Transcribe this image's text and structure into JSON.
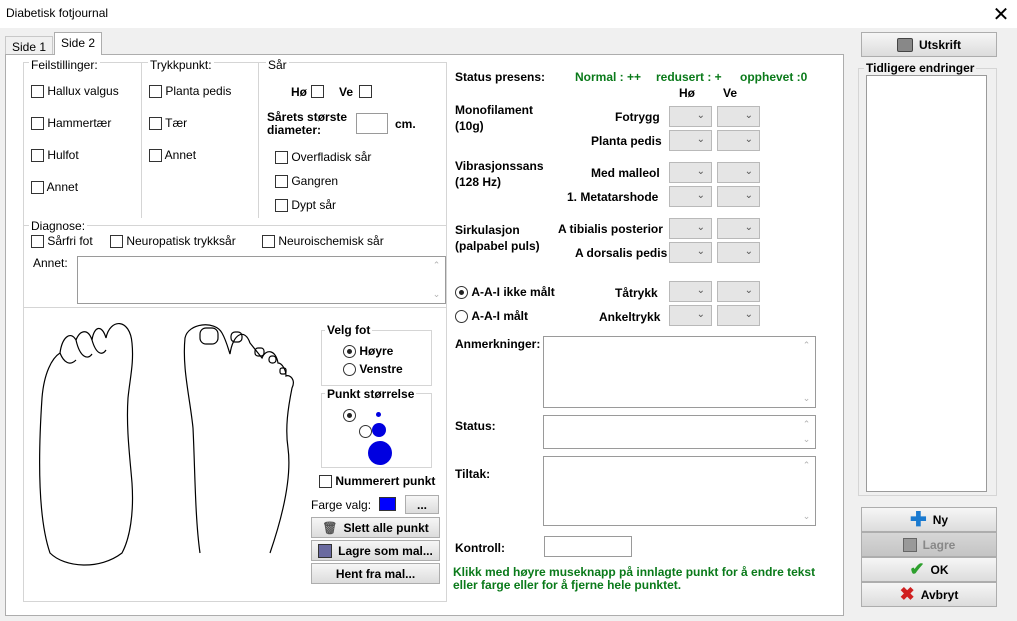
{
  "window": {
    "title": "Diabetisk fotjournal",
    "close_glyph": "✕"
  },
  "tabs": [
    {
      "label": "Side 1"
    },
    {
      "label": "Side 2"
    }
  ],
  "feilstillinger": {
    "title": "Feilstillinger:",
    "items": [
      "Hallux valgus",
      "Hammertær",
      "Hulfot",
      "Annet"
    ]
  },
  "trykkpunkt": {
    "title": "Trykkpunkt:",
    "items": [
      "Planta pedis",
      "Tær",
      "Annet"
    ]
  },
  "sar": {
    "title": "Sår",
    "ho": "Hø",
    "ve": "Ve",
    "diameter_label": "Sårets største diameter:",
    "diameter_unit": "cm.",
    "items": [
      "Overfladisk sår",
      "Gangren",
      "Dypt sår"
    ]
  },
  "diagnose": {
    "title": "Diagnose:",
    "items": [
      "Sårfri fot",
      "Neuropatisk trykksår",
      "Neuroischemisk sår"
    ],
    "annet_label": "Annet:"
  },
  "velg_fot": {
    "title": "Velg fot",
    "options": [
      "Høyre",
      "Venstre"
    ],
    "selected": "Høyre"
  },
  "punkt_storrelse": {
    "title": "Punkt størrelse"
  },
  "nummerert": "Nummerert punkt",
  "farge": {
    "label": "Farge valg:",
    "button": "...",
    "color": "#0000ff"
  },
  "buttons_left": {
    "slett": "Slett alle punkt",
    "lagre_mal": "Lagre som mal...",
    "hent_mal": "Hent fra mal..."
  },
  "status_presens": {
    "label": "Status presens:",
    "normal": "Normal : ++",
    "redusert": "redusert : +",
    "opphevet": "opphevet :0",
    "col_ho": "Hø",
    "col_ve": "Ve"
  },
  "monofilament": {
    "label": "Monofilament (10g)",
    "rows": [
      "Fotrygg",
      "Planta pedis"
    ]
  },
  "vibrasjon": {
    "label": "Vibrasjonssans (128 Hz)",
    "rows": [
      "Med malleol",
      "1. Metatarshode"
    ]
  },
  "sirkulasjon": {
    "label": "Sirkulasjon (palpabel puls)",
    "rows": [
      "A tibialis posterior",
      "A dorsalis pedis"
    ]
  },
  "aai": {
    "options": [
      "A-A-I ikke målt",
      "A-A-I målt"
    ],
    "selected": "A-A-I ikke målt",
    "rows": [
      "Tåtrykk",
      "Ankeltrykk"
    ]
  },
  "fields": {
    "anmerkninger": "Anmerkninger:",
    "status": "Status:",
    "tiltak": "Tiltak:",
    "kontroll": "Kontroll:"
  },
  "hint": "Klikk med høyre museknapp på innlagte punkt for å endre tekst eller farge eller for å fjerne hele punktet.",
  "right": {
    "utskrift": "Utskrift",
    "tidligere": "Tidligere endringer",
    "ny": "Ny",
    "lagre": "Lagre",
    "ok": "OK",
    "avbryt": "Avbryt"
  },
  "icons": [
    "close-icon",
    "printer-icon",
    "trash-icon",
    "save-icon",
    "plus-icon",
    "checkmark-icon",
    "x-mark-icon",
    "chevron-down-icon"
  ]
}
